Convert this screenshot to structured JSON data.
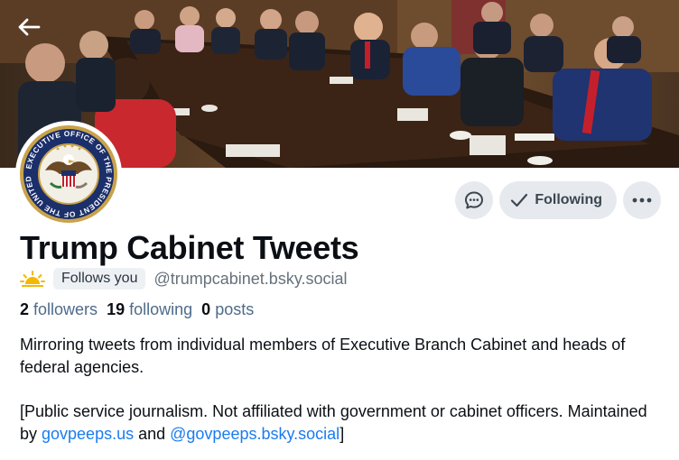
{
  "profile": {
    "display_name": "Trump Cabinet Tweets",
    "follows_you_label": "Follows you",
    "handle": "@trumpcabinet.bsky.social",
    "stats": {
      "followers_count": "2",
      "followers_label": "followers",
      "following_count": "19",
      "following_label": "following",
      "posts_count": "0",
      "posts_label": "posts"
    },
    "bio": {
      "line1": "Mirroring tweets from individual members of Executive Branch Cabinet and heads of federal agencies.",
      "line2_prefix": "[Public service journalism.  Not affiliated with government or cabinet officers. Maintained by ",
      "link1": "govpeeps.us",
      "and_text": " and ",
      "link2": "@govpeeps.bsky.social",
      "suffix": "]"
    },
    "avatar_seal_text": "EXECUTIVE OFFICE OF THE PRESIDENT OF THE UNITED STATES"
  },
  "actions": {
    "following_label": "Following"
  },
  "icons": {
    "back": "arrow-left-icon",
    "message": "message-bubble-icon",
    "check": "check-icon",
    "more": "more-horizontal-icon",
    "sun": "sun-emoji-icon"
  },
  "colors": {
    "link": "#1a7cf0",
    "button_bg": "#e6eaee",
    "stats_label": "#4d6b8a",
    "handle": "#66717c"
  }
}
